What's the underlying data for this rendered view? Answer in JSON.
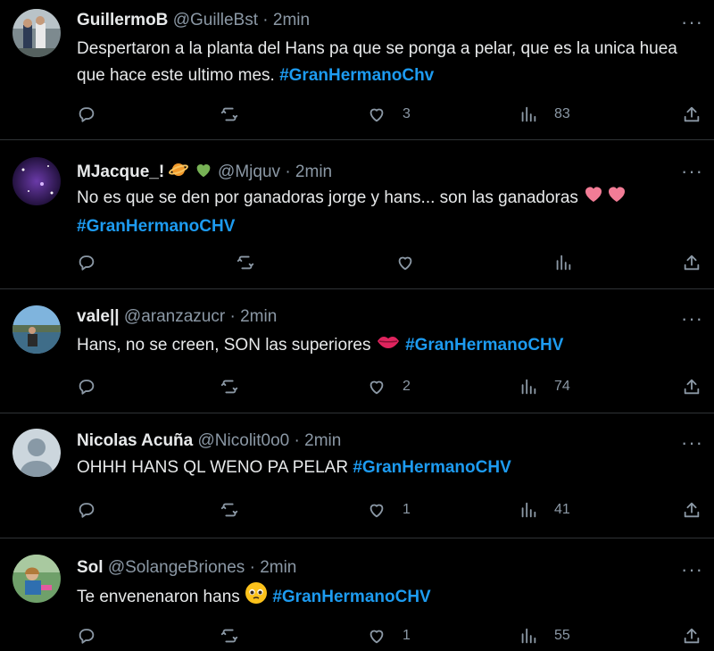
{
  "tweets": [
    {
      "name": "GuillermoB",
      "handle": "@GuilleBst",
      "time": "2min",
      "text": "Despertaron a la planta del Hans pa que se ponga a pelar, que es la unica huea que hace este ultimo mes.",
      "hashtag": "#GranHermanoChv",
      "likes": "3",
      "views": "83"
    },
    {
      "name": "MJacque_!",
      "handle": "@Mjquv",
      "time": "2min",
      "text": "No es que se den por ganadoras jorge y hans... son las ganadoras",
      "hashtag": "#GranHermanoCHV",
      "likes": "",
      "views": ""
    },
    {
      "name": "vale||",
      "handle": "@aranzazucr",
      "time": "2min",
      "text": "Hans, no se creen, SON las superiores",
      "hashtag": "#GranHermanoCHV",
      "likes": "2",
      "views": "74"
    },
    {
      "name": "Nicolas Acuña",
      "handle": "@Nicolit0o0",
      "time": "2min",
      "text": "OHHH HANS QL WENO PA PELAR",
      "hashtag": "#GranHermanoCHV",
      "likes": "1",
      "views": "41"
    },
    {
      "name": "Sol",
      "handle": "@SolangeBriones",
      "time": "2min",
      "text": "Te envenenaron hans",
      "hashtag": "#GranHermanoCHV",
      "likes": "1",
      "views": "55"
    }
  ],
  "separator": "·",
  "more_label": "···",
  "colors": {
    "hashtag": "#1d9bf0",
    "muted": "#8b98a5",
    "divider": "#2f3336"
  }
}
